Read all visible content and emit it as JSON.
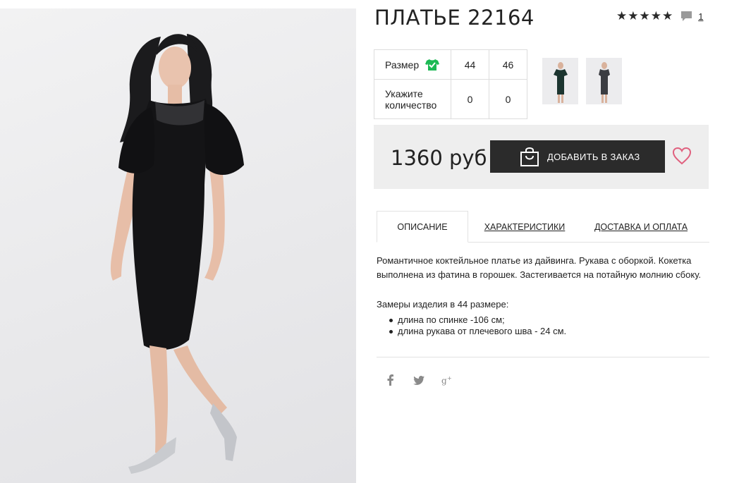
{
  "product": {
    "title": "ПЛАТЬЕ 22164",
    "rating_stars": "★★★★★",
    "comments_count": "1",
    "price": "1360 руб"
  },
  "size_table": {
    "size_label": "Размер",
    "qty_label_line1": "Укажите",
    "qty_label_line2": "количество",
    "sizes": [
      "44",
      "46"
    ],
    "quantities": [
      "0",
      "0"
    ]
  },
  "actions": {
    "add_to_order": "ДОБАВИТЬ В ЗАКАЗ"
  },
  "tabs": [
    {
      "label": "ОПИСАНИЕ",
      "active": true
    },
    {
      "label": "ХАРАКТЕРИСТИКИ",
      "active": false
    },
    {
      "label": "ДОСТАВКА И ОПЛАТА",
      "active": false
    }
  ],
  "description": {
    "text": "Романтичное коктейльное платье из дайвинга. Рукава с оборкой. Кокетка выполнена из фатина в горошек. Застегивается на потайную молнию сбоку.",
    "measurements_title": "Замеры изделия в 44 размере:",
    "measurements": [
      "длина по спинке -106 см;",
      "длина рукава от плечевого шва - 24 см."
    ]
  },
  "icons": {
    "size_chart": "shirt-check-icon",
    "cart": "shopping-bag-icon",
    "wishlist": "heart-icon",
    "comments": "comment-icon",
    "social": [
      "facebook-icon",
      "twitter-icon",
      "google-plus-icon"
    ]
  },
  "colors": {
    "accent_green": "#1db954",
    "button_dark": "#2b2b2b",
    "heart_pink": "#e0607e",
    "price_band_bg": "#eeeeee"
  }
}
